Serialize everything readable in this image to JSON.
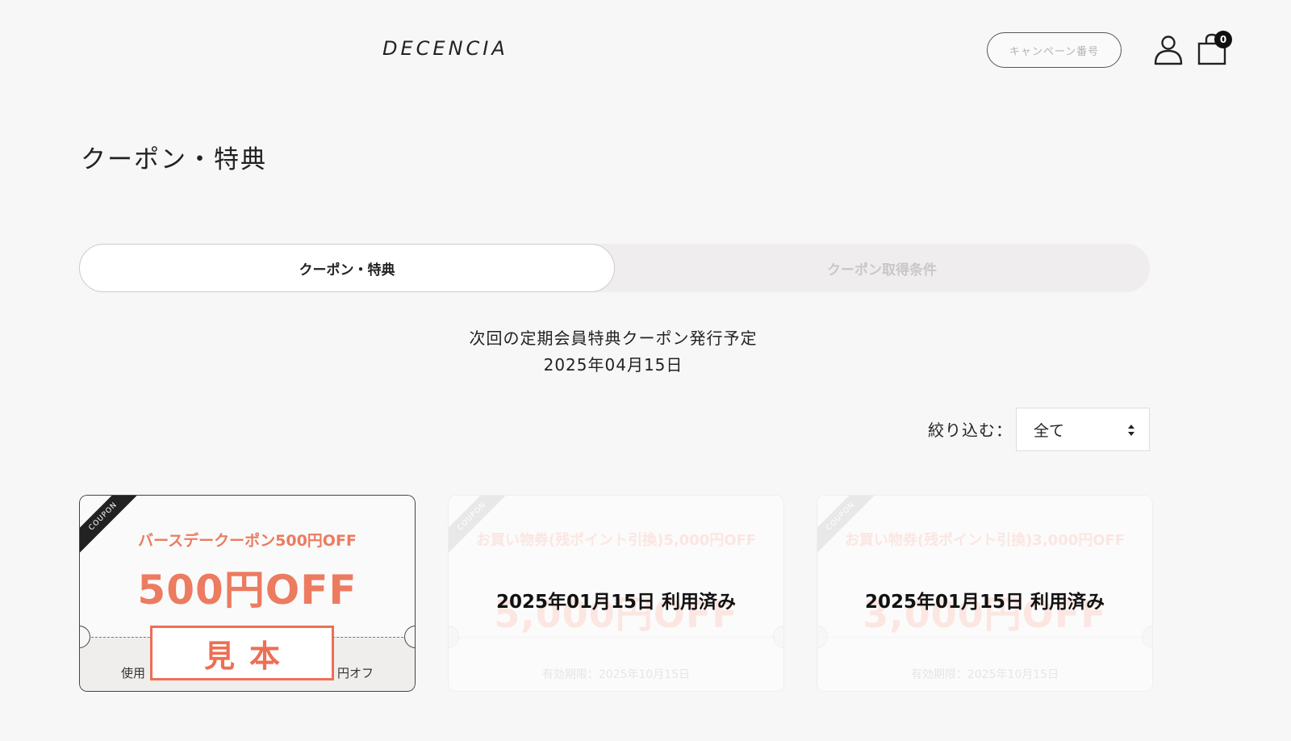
{
  "header": {
    "logo": "DECENCIA",
    "campaign_button": "キャンペーン番号",
    "cart_count": "0"
  },
  "page_title": "クーポン・特典",
  "tabs": [
    {
      "label": "クーポン・特典",
      "active": true
    },
    {
      "label": "クーポン取得条件",
      "active": false
    }
  ],
  "next_issue": {
    "label": "次回の定期会員特典クーポン発行予定",
    "date": "2025年04月15日"
  },
  "filter": {
    "label": "絞り込む：",
    "selected": "全て"
  },
  "coupons": [
    {
      "ribbon": "COUPON",
      "name": "バースデークーポン500円OFF",
      "amount": "500円OFF",
      "condition_prefix": "使用",
      "condition_suffix": "円オフ",
      "stamp": "見本"
    },
    {
      "ribbon": "COUPON",
      "name": "お買い物券(残ポイント引換)5,000円OFF",
      "amount": "5,000円OFF",
      "used_label": "2025年01月15日 利用済み",
      "expiry": "有効期限：2025年10月15日"
    },
    {
      "ribbon": "COUPON",
      "name": "お買い物券(残ポイント引換)3,000円OFF",
      "amount": "3,000円OFF",
      "used_label": "2025年01月15日 利用済み",
      "expiry": "有効期限：2025年10月15日"
    }
  ],
  "colors": {
    "accent": "#ec7b60",
    "background": "#f7f7f7"
  }
}
